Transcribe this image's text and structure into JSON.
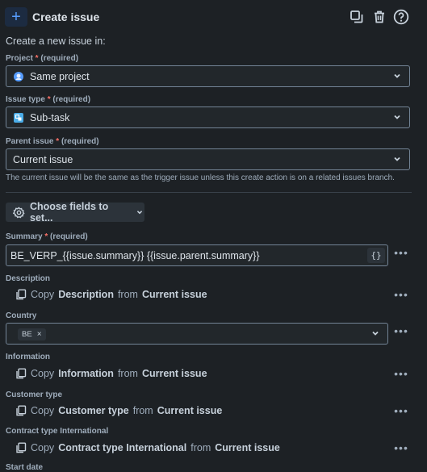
{
  "header": {
    "title": "Create issue"
  },
  "intro": "Create a new issue in:",
  "project": {
    "label": "Project",
    "required": "(required)",
    "value": "Same project"
  },
  "issue_type": {
    "label": "Issue type",
    "required": "(required)",
    "value": "Sub-task"
  },
  "parent_issue": {
    "label": "Parent issue",
    "required": "(required)",
    "value": "Current issue",
    "help": "The current issue will be the same as the trigger issue unless this create action is on a related issues branch."
  },
  "choose_fields": {
    "label": "Choose fields to set..."
  },
  "summary": {
    "label": "Summary",
    "required": "(required)",
    "value": "BE_VERP_{{issue.summary}} {{issue.parent.summary}}",
    "braces": "{}"
  },
  "description": {
    "label": "Description",
    "copy": "Copy",
    "field": "Description",
    "from": "from",
    "source": "Current issue"
  },
  "country": {
    "label": "Country",
    "chip": "BE",
    "chip_remove": "×"
  },
  "information": {
    "label": "Information",
    "copy": "Copy",
    "field": "Information",
    "from": "from",
    "source": "Current issue"
  },
  "customer_type": {
    "label": "Customer type",
    "copy": "Copy",
    "field": "Customer type",
    "from": "from",
    "source": "Current issue"
  },
  "contract_type": {
    "label": "Contract type International",
    "copy": "Copy",
    "field": "Contract type International",
    "from": "from",
    "source": "Current issue"
  },
  "start_date": {
    "label": "Start date"
  },
  "colors": {
    "background": "#1d2125",
    "accent": "#579dff",
    "required_star": "#f87168",
    "border": "#738496"
  },
  "icons": [
    "plus-icon",
    "duplicate-icon",
    "trash-icon",
    "help-icon",
    "project-avatar-icon",
    "subtask-icon",
    "chevron-down-icon",
    "gear-icon",
    "more-icon",
    "copy-icon",
    "close-icon"
  ]
}
